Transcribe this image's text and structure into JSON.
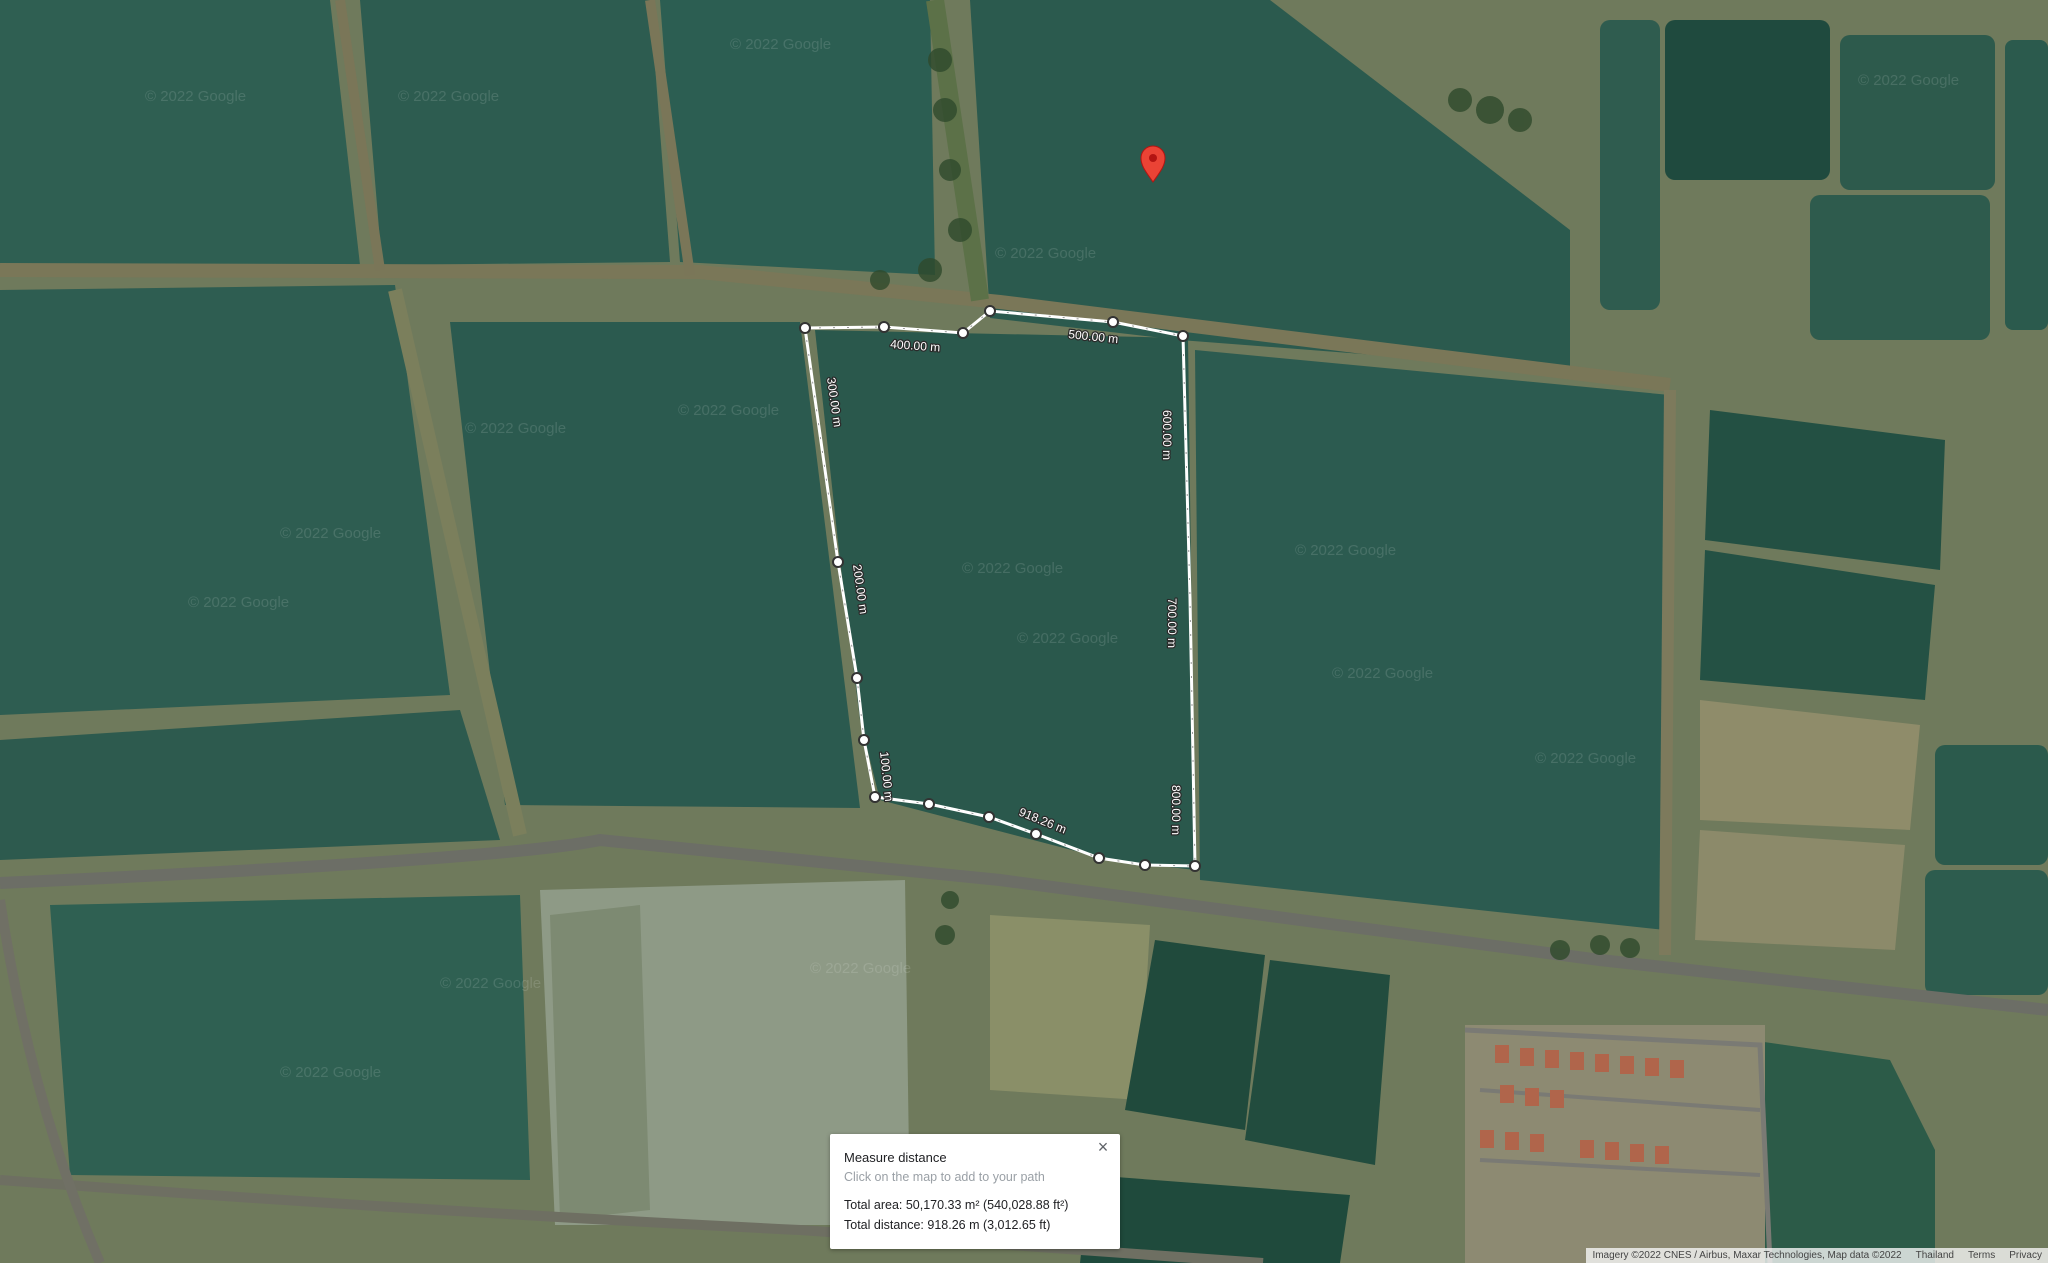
{
  "map": {
    "view": "satellite",
    "watermark_text": "© 2022 Google",
    "pin_color": "#ea4335",
    "measure_line_color": "#ffffff"
  },
  "measure_path": {
    "segment_labels": [
      "400.00 m",
      "500.00 m",
      "600.00 m",
      "700.00 m",
      "800.00 m",
      "918.26 m",
      "100.00 m",
      "200.00 m",
      "300.00 m"
    ]
  },
  "measure_card": {
    "title": "Measure distance",
    "hint": "Click on the map to add to your path",
    "total_area": "Total area: 50,170.33 m² (540,028.88 ft²)",
    "total_distance": "Total distance: 918.26 m (3,012.65 ft)",
    "close_icon": "×"
  },
  "attribution": {
    "imagery": "Imagery ©2022 CNES / Airbus, Maxar Technologies, Map data ©2022",
    "region": "Thailand",
    "terms": "Terms",
    "privacy": "Privacy"
  }
}
